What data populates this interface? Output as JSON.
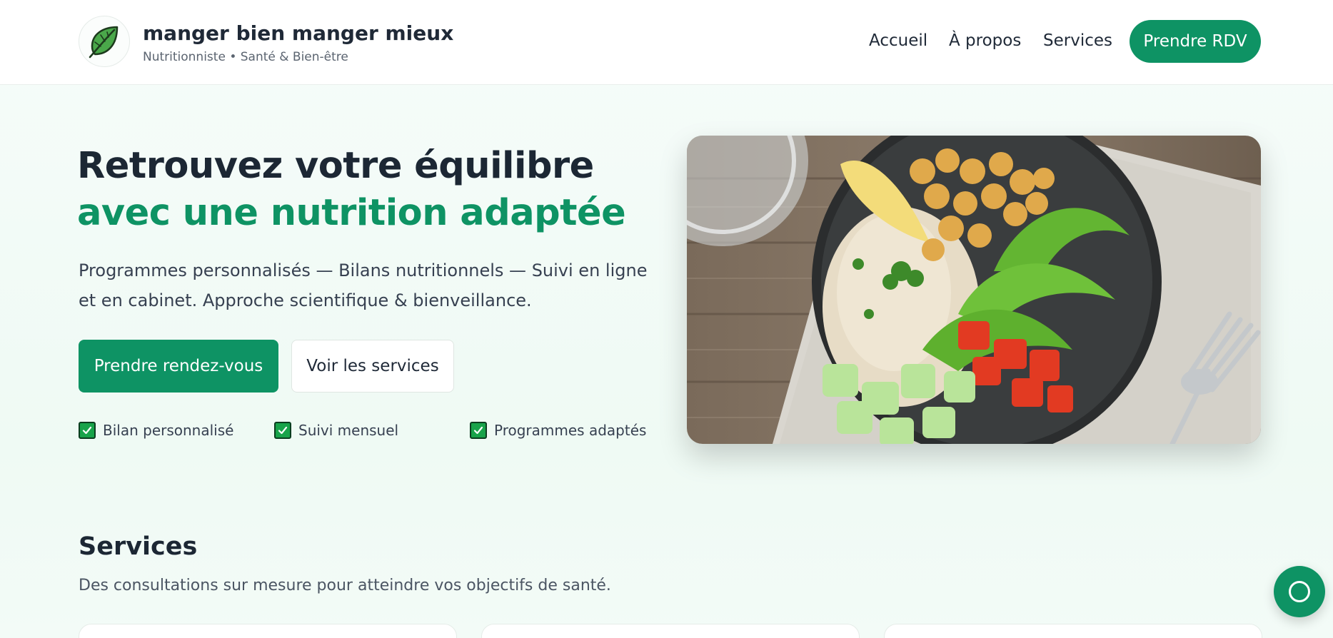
{
  "header": {
    "brand_name": "manger bien manger mieux",
    "brand_tagline": "Nutritionniste • Santé & Bien-être",
    "logo_icon": "leaf-icon",
    "nav": [
      "Accueil",
      "À propos",
      "Services"
    ],
    "cta_label": "Prendre RDV"
  },
  "hero": {
    "title_line1": "Retrouvez votre équilibre",
    "title_line2": "avec une nutrition adaptée",
    "description": "Programmes personnalisés — Bilans nutritionnels — Suivi en ligne et en cabinet. Approche scientifique & bienveillance.",
    "primary_button": "Prendre rendez-vous",
    "secondary_button": "Voir les services",
    "features": [
      "Bilan personnalisé",
      "Suivi mensuel",
      "Programmes adaptés"
    ],
    "feature_icon": "checkbox-checked-icon"
  },
  "services": {
    "title": "Services",
    "subtitle": "Des consultations sur mesure pour atteindre vos objectifs de santé."
  },
  "fab": {
    "icon": "chat-circle-icon"
  },
  "colors": {
    "accent": "#0e9364",
    "heading": "#1c2734",
    "check_green": "#18a34a"
  }
}
